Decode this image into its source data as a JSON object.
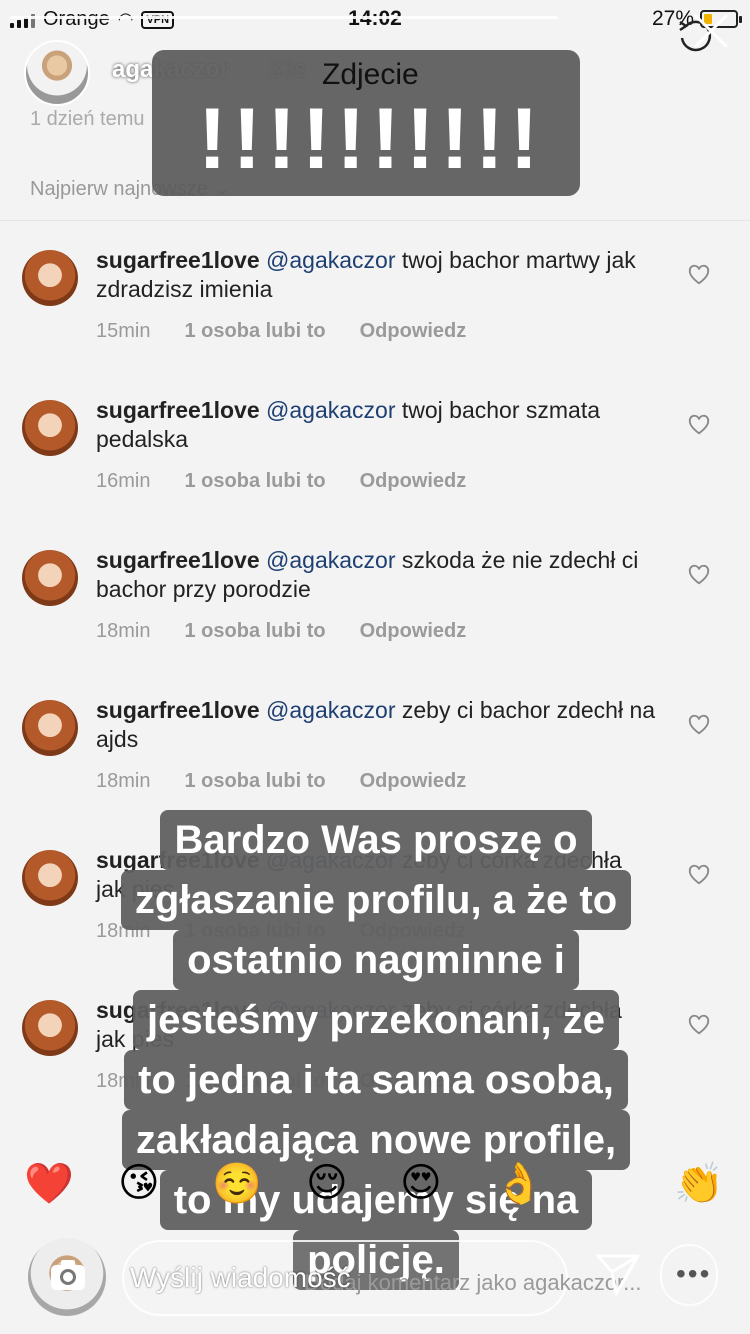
{
  "status": {
    "carrier": "Orange",
    "vpn": "VPN",
    "time": "14:02",
    "battery_percent": "27%",
    "battery_level": 0.27
  },
  "story": {
    "username": "agakaczor",
    "elapsed": "33s",
    "progress": 1.0
  },
  "caption_top": {
    "title": "Zdjecie",
    "exclamations": "!!!!!!!!!!"
  },
  "comments_page": {
    "ghost_top": "1 dzień temu",
    "sort_label": "Najpierw najnowsze"
  },
  "comments": [
    {
      "user": "sugarfree1love",
      "mention": "@agakaczor",
      "text": "twoj bachor martwy jak zdradzisz imienia",
      "time": "15min",
      "likes": "1 osoba lubi to",
      "reply": "Odpowiedz"
    },
    {
      "user": "sugarfree1love",
      "mention": "@agakaczor",
      "text": "twoj bachor szmata pedalska",
      "time": "16min",
      "likes": "1 osoba lubi to",
      "reply": "Odpowiedz"
    },
    {
      "user": "sugarfree1love",
      "mention": "@agakaczor",
      "text": "szkoda że nie zdechł ci bachor przy porodzie",
      "time": "18min",
      "likes": "1 osoba lubi to",
      "reply": "Odpowiedz"
    },
    {
      "user": "sugarfree1love",
      "mention": "@agakaczor",
      "text": "zeby ci bachor zdechł na ajds",
      "time": "18min",
      "likes": "1 osoba lubi to",
      "reply": "Odpowiedz"
    },
    {
      "user": "sugarfree1love",
      "mention": "@agakaczor",
      "text": "zeby ci córka zdechła jak pies",
      "time": "18min",
      "likes": "1 osoba lubi to",
      "reply": "Odpowiedz"
    },
    {
      "user": "sugarfree1love",
      "mention": "@agakaczor",
      "text": "zeby ci córka zdechła jak pies",
      "time": "18min",
      "likes": "1 osoba lubi to",
      "reply": "Odpowiedz"
    }
  ],
  "caption_big": {
    "lines": [
      "Bardzo Was proszę o",
      "zgłaszanie profilu, a że to",
      "ostatnio nagminne i",
      "jesteśmy przekonani, że",
      "to jedna i ta sama osoba,",
      "zakładająca nowe profile,",
      "to my udajemy się na",
      "policję."
    ]
  },
  "reactions": [
    "❤️",
    "😘",
    "☺️",
    "😌",
    "😍",
    "👌",
    "👏"
  ],
  "bottom_bar": {
    "message_placeholder": "Wyślij wiadomość",
    "ghost_comment": "Dodaj komentarz jako agakaczor...",
    "more": "•••"
  }
}
